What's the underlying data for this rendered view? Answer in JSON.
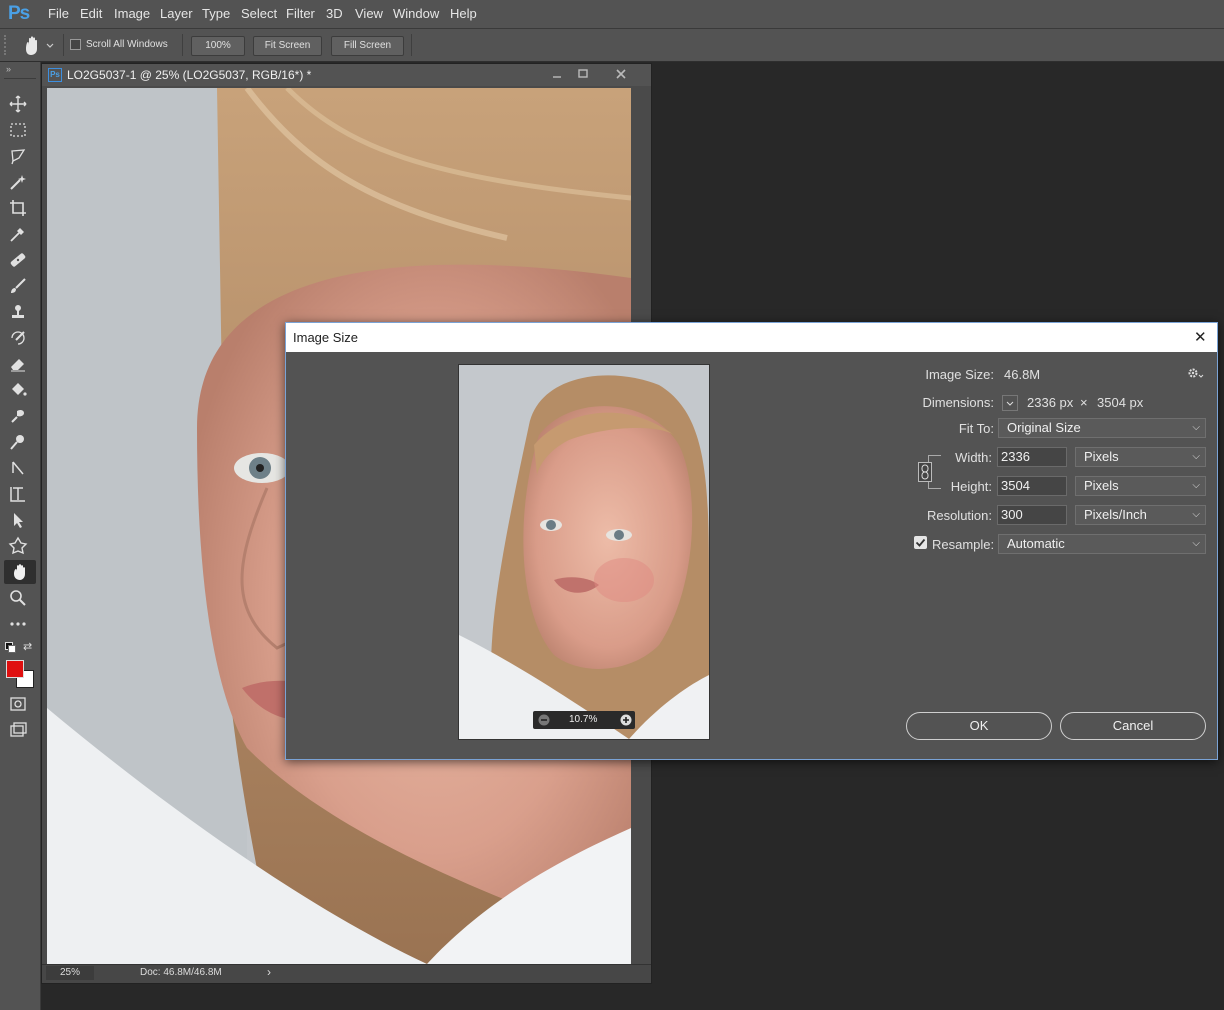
{
  "app": {
    "logo": "Ps"
  },
  "menu": [
    "File",
    "Edit",
    "Image",
    "Layer",
    "Type",
    "Select",
    "Filter",
    "3D",
    "View",
    "Window",
    "Help"
  ],
  "options": {
    "scroll_all_windows": "Scroll All Windows",
    "zoom_100": "100%",
    "fit_screen": "Fit Screen",
    "fill_screen": "Fill Screen"
  },
  "toolbox": {
    "tools": [
      "move-icon",
      "marquee-icon",
      "lasso-icon",
      "quick-select-icon",
      "crop-icon",
      "eyedropper-icon",
      "healing-brush-icon",
      "brush-icon",
      "stamp-icon",
      "history-brush-icon",
      "eraser-icon",
      "paint-bucket-icon",
      "smudge-icon",
      "dodge-icon",
      "pen-icon",
      "type-icon",
      "path-select-icon",
      "shape-icon",
      "hand-icon",
      "zoom-icon",
      "more-icon"
    ],
    "foreground_color": "#e01010",
    "background_color": "#ffffff"
  },
  "document": {
    "tab_badge": "Ps",
    "title": "LO2G5037-1 @ 25% (LO2G5037, RGB/16*) *",
    "zoom": "25%",
    "doc_size": "Doc: 46.8M/46.8M"
  },
  "dialog": {
    "title": "Image Size",
    "close": "✕",
    "image_size_label": "Image Size:",
    "image_size_value": "46.8M",
    "dimensions_label": "Dimensions:",
    "dim_width": "2336 px",
    "dim_x": "×",
    "dim_height": "3504 px",
    "fit_to_label": "Fit To:",
    "fit_to_value": "Original Size",
    "width_label": "Width:",
    "width_value": "2336",
    "width_unit": "Pixels",
    "height_label": "Height:",
    "height_value": "3504",
    "height_unit": "Pixels",
    "resolution_label": "Resolution:",
    "resolution_value": "300",
    "resolution_unit": "Pixels/Inch",
    "resample_label": "Resample:",
    "resample_checked": true,
    "resample_value": "Automatic",
    "preview_zoom": "10.7%",
    "ok": "OK",
    "cancel": "Cancel"
  },
  "colors": {
    "ui_bg": "#535353",
    "canvas_bg": "#282828",
    "dialog_border": "#7aa3d6"
  }
}
